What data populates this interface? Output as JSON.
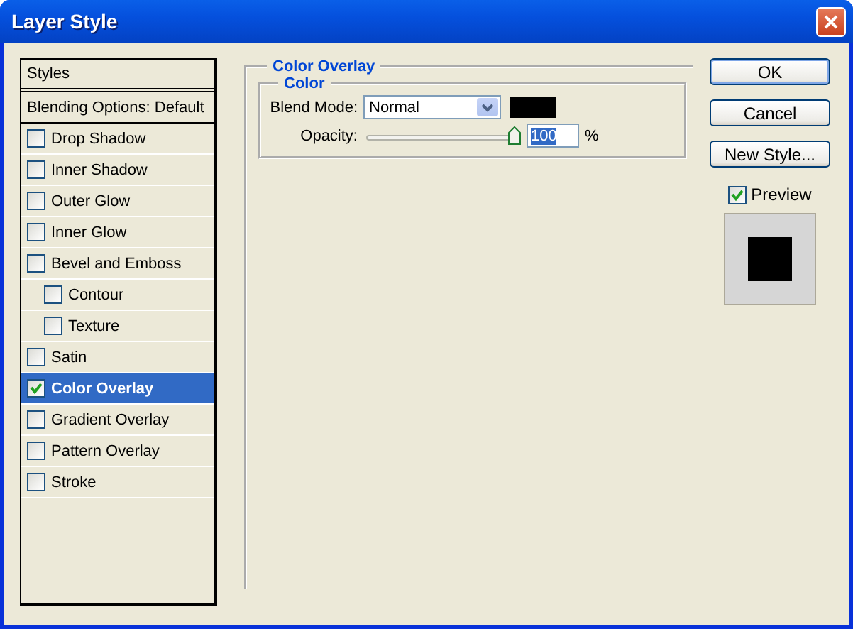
{
  "window": {
    "title": "Layer Style"
  },
  "styles_list": {
    "header": "Styles",
    "blending_options": "Blending Options: Default",
    "items": [
      {
        "label": "Drop Shadow",
        "checked": false,
        "selected": false
      },
      {
        "label": "Inner Shadow",
        "checked": false,
        "selected": false
      },
      {
        "label": "Outer Glow",
        "checked": false,
        "selected": false
      },
      {
        "label": "Inner Glow",
        "checked": false,
        "selected": false
      },
      {
        "label": "Bevel and Emboss",
        "checked": false,
        "selected": false,
        "children": [
          {
            "label": "Contour",
            "checked": false,
            "selected": false
          },
          {
            "label": "Texture",
            "checked": false,
            "selected": false
          }
        ]
      },
      {
        "label": "Satin",
        "checked": false,
        "selected": false
      },
      {
        "label": "Color Overlay",
        "checked": true,
        "selected": true
      },
      {
        "label": "Gradient Overlay",
        "checked": false,
        "selected": false
      },
      {
        "label": "Pattern Overlay",
        "checked": false,
        "selected": false
      },
      {
        "label": "Stroke",
        "checked": false,
        "selected": false
      }
    ]
  },
  "panel": {
    "title": "Color Overlay",
    "group": {
      "title": "Color",
      "blend_mode_label": "Blend Mode:",
      "blend_mode": "Normal",
      "color": "#000000",
      "opacity_label": "Opacity:",
      "opacity": {
        "level": 1.0,
        "value": "100",
        "unit": "%"
      }
    }
  },
  "buttons": [
    "OK",
    "Cancel",
    "New Style..."
  ],
  "preview": {
    "label": "Preview",
    "checked": true
  }
}
